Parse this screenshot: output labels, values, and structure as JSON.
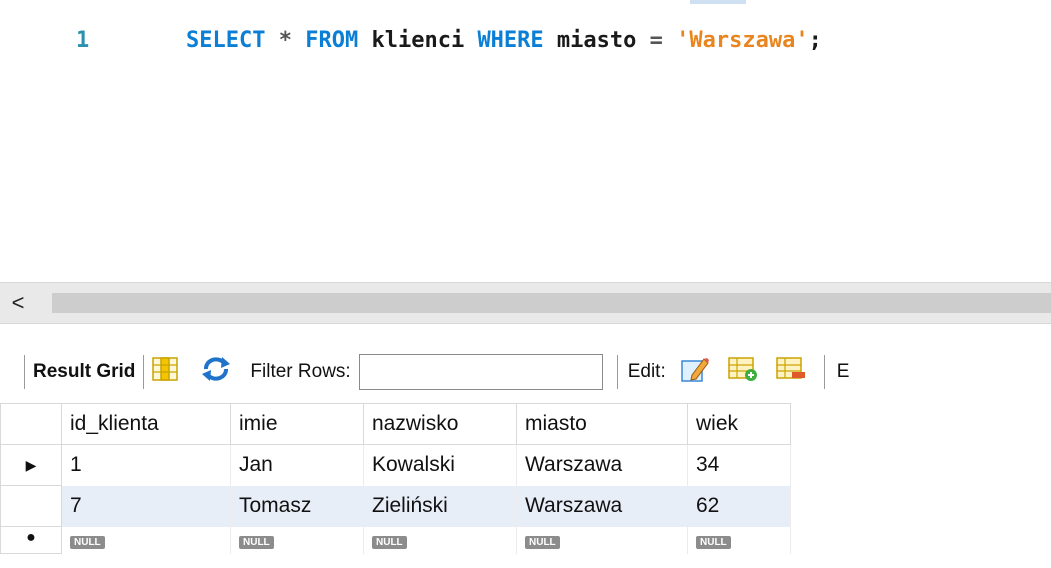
{
  "editor": {
    "line_number": "1",
    "tokens": {
      "select": "SELECT",
      "star": "*",
      "from": "FROM",
      "table": "klienci",
      "where": "WHERE",
      "column": "miasto",
      "equals": "=",
      "value": "'Warszawa'",
      "semicolon": ";"
    }
  },
  "scrollbar": {
    "left_arrow": "<"
  },
  "toolbar": {
    "result_grid_label": "Result Grid",
    "filter_label": "Filter Rows:",
    "filter_value": "",
    "edit_label": "Edit:",
    "truncated_label": "E"
  },
  "grid": {
    "columns": [
      "id_klienta",
      "imie",
      "nazwisko",
      "miasto",
      "wiek"
    ],
    "rows": [
      [
        "1",
        "Jan",
        "Kowalski",
        "Warszawa",
        "34"
      ],
      [
        "7",
        "Tomasz",
        "Zieliński",
        "Warszawa",
        "62"
      ]
    ],
    "null_label": "NULL",
    "current_row_marker": "▶",
    "new_row_marker": "●"
  },
  "colors": {
    "keyword": "#0b7fd6",
    "string": "#e9851f",
    "line_number": "#2b91af",
    "alt_row": "#e8eef8"
  }
}
